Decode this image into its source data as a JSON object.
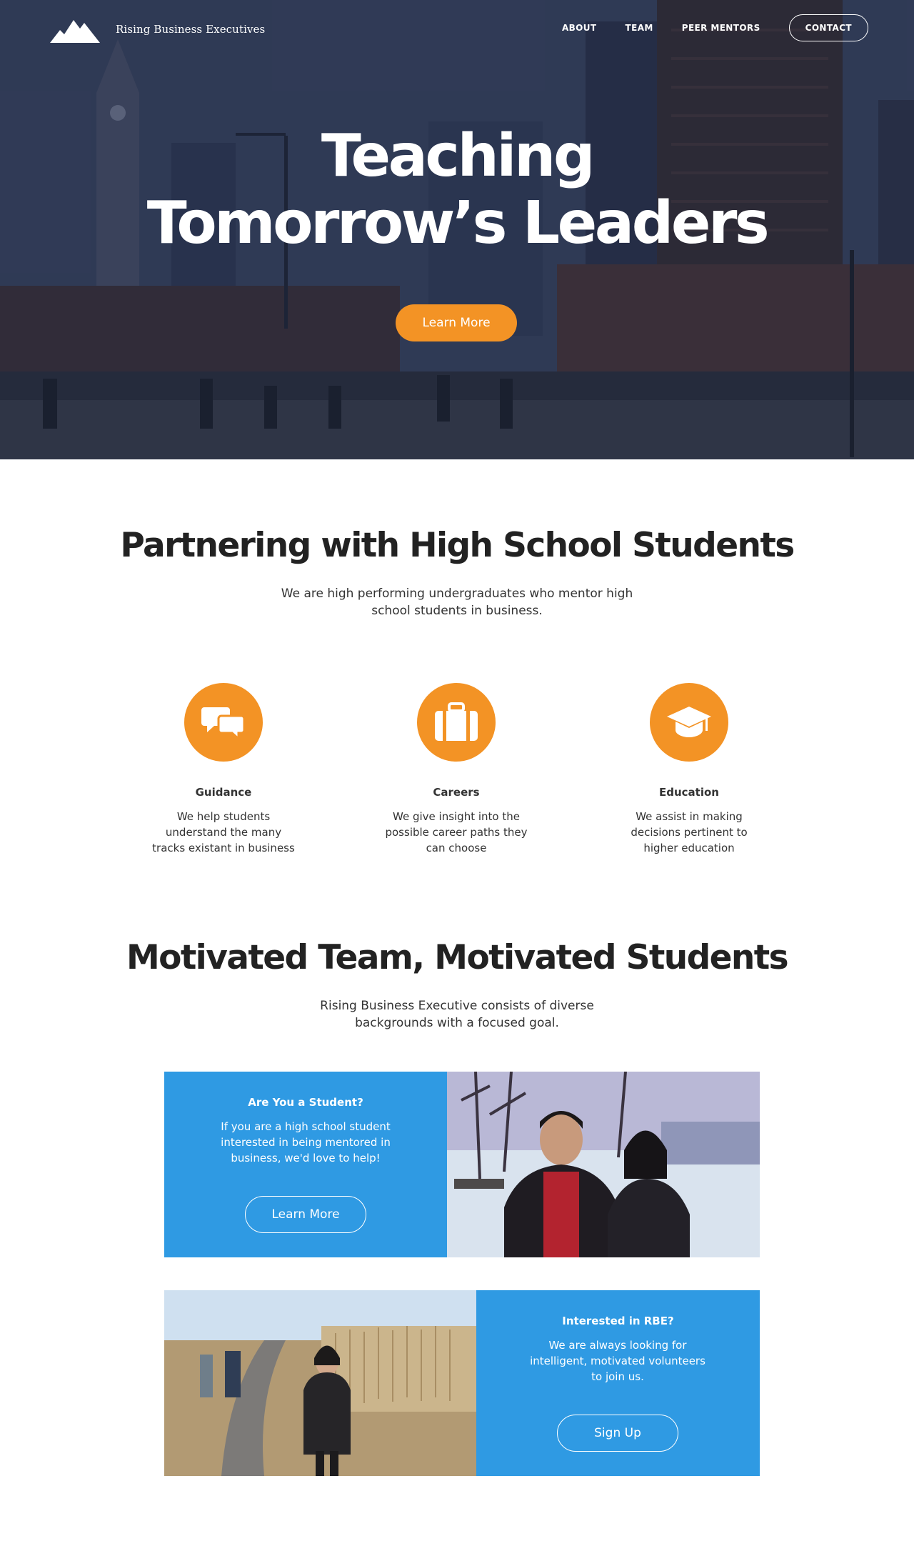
{
  "brand": {
    "name": "Rising Business Executives",
    "icon": "mountain-icon"
  },
  "nav": {
    "items": [
      "ABOUT",
      "TEAM",
      "PEER MENTORS"
    ],
    "contact": "CONTACT"
  },
  "hero": {
    "title_line1": "Teaching",
    "title_line2": "Tomorrow’s Leaders",
    "button": "Learn More"
  },
  "partnering": {
    "title": "Partnering with High School Students",
    "subtitle": "We are high performing undergraduates who mentor high school students in business.",
    "features": [
      {
        "icon": "chat-bubbles-icon",
        "title": "Guidance",
        "desc": "We help students understand the many tracks existant in business"
      },
      {
        "icon": "briefcase-icon",
        "title": "Careers",
        "desc": "We give insight into the possible career paths they can choose"
      },
      {
        "icon": "graduation-cap-icon",
        "title": "Education",
        "desc": "We assist in making decisions pertinent to higher education"
      }
    ]
  },
  "team": {
    "title": "Motivated Team, Motivated Students",
    "subtitle": "Rising Business Executive consists of diverse backgrounds with a focused goal."
  },
  "cards": [
    {
      "heading": "Are You a Student?",
      "text": "If you are a high school student interested in being mentored in business, we'd love to help!",
      "button": "Learn More"
    },
    {
      "heading": "Interested in RBE?",
      "text": "We are always looking for intelligent, motivated volunteers to join us.",
      "button": "Sign Up"
    }
  ],
  "colors": {
    "accent": "#f39325",
    "card_blue": "#2f9ae3",
    "text": "#222222"
  }
}
